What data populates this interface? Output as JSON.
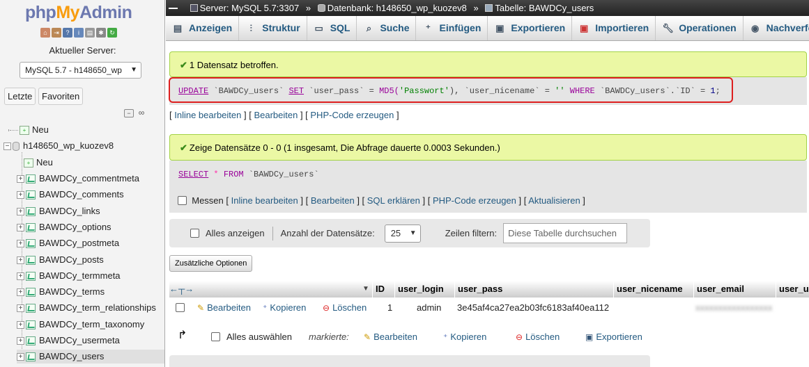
{
  "sidebar": {
    "logo": {
      "php": "php",
      "my": "My",
      "admin": "Admin"
    },
    "server_label": "Aktueller Server:",
    "server_select": "MySQL 5.7 - h148650_wp",
    "tabs": [
      "Letzte",
      "Favoriten"
    ],
    "tree": {
      "new": "Neu",
      "db": "h148650_wp_kuozev8",
      "db_new": "Neu",
      "tables": [
        "BAWDCy_commentmeta",
        "BAWDCy_comments",
        "BAWDCy_links",
        "BAWDCy_options",
        "BAWDCy_postmeta",
        "BAWDCy_posts",
        "BAWDCy_termmeta",
        "BAWDCy_terms",
        "BAWDCy_term_relationships",
        "BAWDCy_term_taxonomy",
        "BAWDCy_usermeta",
        "BAWDCy_users"
      ]
    }
  },
  "breadcrumb": {
    "server": "Server: MySQL 5.7:3307",
    "database": "Datenbank: h148650_wp_kuozev8",
    "table": "Tabelle: BAWDCy_users",
    "sep": "»"
  },
  "menu": [
    "Anzeigen",
    "Struktur",
    "SQL",
    "Suche",
    "Einfügen",
    "Exportieren",
    "Importieren",
    "Operationen",
    "Nachverfolgen"
  ],
  "success1": "1 Datensatz betroffen.",
  "update_sql": {
    "kw1": "UPDATE",
    "t1": " `BAWDCy_users` ",
    "kw2": "SET",
    "t2": " `user_pass` = ",
    "fn": "MD5(",
    "str": "'Passwort'",
    "t3": "), `user_nicename` = ",
    "str2": "''",
    "t4": " WHERE ",
    "t5": "`BAWDCy_users`.`ID` = ",
    "num": "1",
    ";": ";"
  },
  "links1": {
    "a": "Inline bearbeiten",
    "b": "Bearbeiten",
    "c": "PHP-Code erzeugen"
  },
  "success2": "Zeige Datensätze 0 - 0 (1 insgesamt, Die Abfrage dauerte 0.0003 Sekunden.)",
  "select_sql": {
    "kw": "SELECT",
    "star": " * ",
    "from": "FROM",
    "tbl": " `BAWDCy_users`"
  },
  "links2": {
    "messen": "Messen",
    "a": "Inline bearbeiten",
    "b": "Bearbeiten",
    "c": "SQL erklären",
    "d": "PHP-Code erzeugen",
    "e": "Aktualisieren"
  },
  "toolbar": {
    "show_all": "Alles anzeigen",
    "rows_label": "Anzahl der Datensätze:",
    "rows_value": "25",
    "filter_label": "Zeilen filtern:",
    "filter_placeholder": "Diese Tabelle durchsuchen"
  },
  "options_button": "Zusätzliche Optionen",
  "table": {
    "headers": [
      "ID",
      "user_login",
      "user_pass",
      "user_nicename",
      "user_email",
      "user_u"
    ],
    "row": {
      "edit": "Bearbeiten",
      "copy": "Kopieren",
      "delete": "Löschen",
      "id": "1",
      "login": "admin",
      "pass": "3e45af4ca27ea2b03fc6183af40ea112"
    }
  },
  "bulk": {
    "select_all": "Alles auswählen",
    "marked": "markierte:",
    "edit": "Bearbeiten",
    "copy": "Kopieren",
    "delete": "Löschen",
    "export": "Exportieren"
  }
}
